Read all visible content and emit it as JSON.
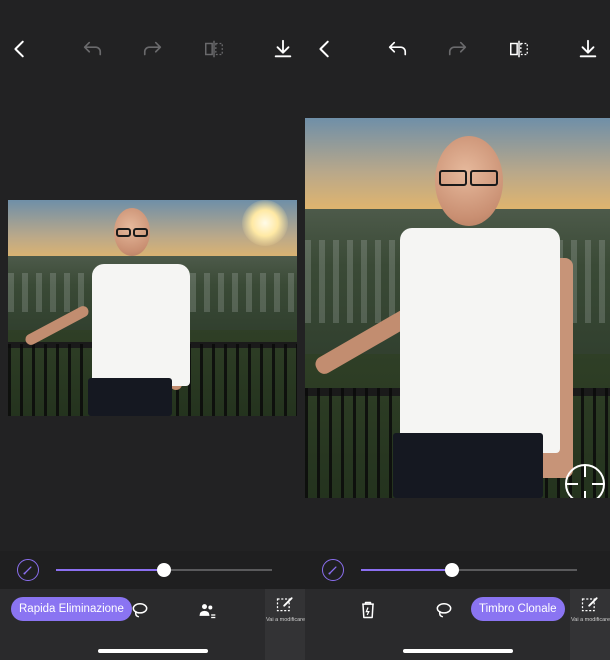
{
  "left_panel": {
    "topbar_icons": [
      "back-chevron-icon",
      "undo-icon",
      "redo-icon",
      "compare-icon",
      "download-icon"
    ],
    "slider": {
      "value_fraction": 0.5
    },
    "toolbar": {
      "active_tool_label": "Rapida Eliminazione",
      "edit_label": "Vai a modificare"
    }
  },
  "right_panel": {
    "topbar_icons": [
      "back-chevron-icon",
      "undo-icon",
      "redo-icon",
      "compare-icon",
      "download-icon"
    ],
    "slider": {
      "value_fraction": 0.42
    },
    "toolbar": {
      "active_tool_label": "Timbro Clonale",
      "edit_label": "Vai a modificare"
    }
  },
  "colors": {
    "accent": "#8a74f2",
    "background": "#222223",
    "toolbar": "#2a2a2c"
  }
}
